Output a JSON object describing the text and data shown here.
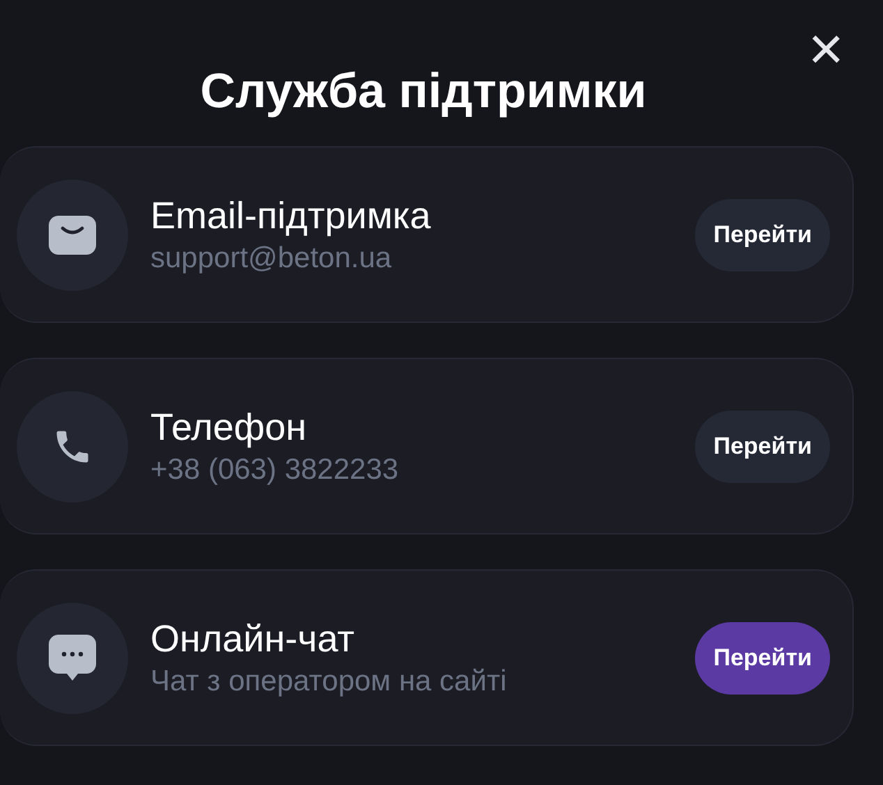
{
  "title": "Служба підтримки",
  "close": "×",
  "channels": [
    {
      "kind": "email",
      "name": "Email-підтримка",
      "detail": "support@beton.ua",
      "action": "Перейти",
      "highlighted": false
    },
    {
      "kind": "phone",
      "name": "Телефон",
      "detail": "+38 (063) 3822233",
      "action": "Перейти",
      "highlighted": false
    },
    {
      "kind": "chat",
      "name": "Онлайн-чат",
      "detail": "Чат з оператором на сайті",
      "action": "Перейти",
      "highlighted": true
    }
  ]
}
